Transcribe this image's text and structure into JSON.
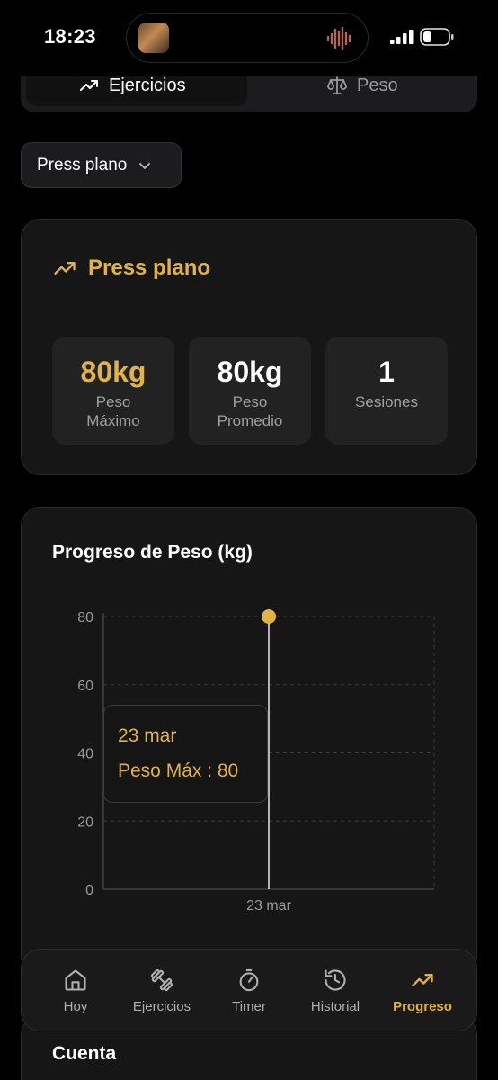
{
  "status_bar": {
    "time": "18:23"
  },
  "segmented": {
    "items": [
      {
        "label": "Ejercicios",
        "active": true,
        "icon": "trending-up-icon"
      },
      {
        "label": "Peso",
        "active": false,
        "icon": "scale-icon"
      }
    ]
  },
  "exercise_select": {
    "value": "Press plano"
  },
  "summary": {
    "title": "Press plano",
    "stats": [
      {
        "value": "80kg",
        "label": "Peso Máximo"
      },
      {
        "value": "80kg",
        "label": "Peso Promedio"
      },
      {
        "value": "1",
        "label": "Sesiones"
      }
    ]
  },
  "chart_card": {
    "title": "Progreso de Peso (kg)"
  },
  "chart_data": {
    "type": "line",
    "title": "Progreso de Peso (kg)",
    "categories": [
      "23 mar"
    ],
    "series": [
      {
        "name": "Peso Máx",
        "values": [
          80
        ]
      }
    ],
    "ylim": [
      0,
      80
    ],
    "yticks": [
      0,
      20,
      40,
      60,
      80
    ],
    "grid": true,
    "active_point": 0
  },
  "tooltip": {
    "date": "23 mar",
    "series_label": "Peso Máx : 80"
  },
  "colors": {
    "accent": "#e2b33e",
    "background": "#000000",
    "card": "#161616"
  },
  "tabbar": {
    "items": [
      {
        "label": "Hoy",
        "icon": "home-icon",
        "active": false
      },
      {
        "label": "Ejercicios",
        "icon": "dumbbell-icon",
        "active": false
      },
      {
        "label": "Timer",
        "icon": "timer-icon",
        "active": false
      },
      {
        "label": "Historial",
        "icon": "history-icon",
        "active": false
      },
      {
        "label": "Progreso",
        "icon": "trending-up-icon",
        "active": true
      }
    ]
  },
  "account": {
    "title": "Cuenta"
  }
}
